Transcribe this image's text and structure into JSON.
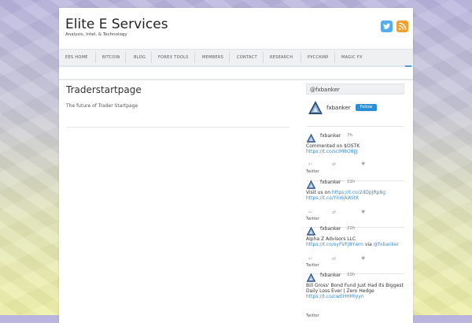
{
  "site": {
    "title": "Elite E Services",
    "tagline": "Analysis, Intel, & Technology"
  },
  "social": {
    "twitter": "twitter-icon",
    "rss": "rss-icon"
  },
  "nav": {
    "items": [
      "EES HOME",
      "BITCOIN",
      "BLOG",
      "FOREX TOOLS",
      "MEMBERS",
      "CONTACT",
      "RESEARCH",
      "РУССКИЙ",
      "MAGIC FX"
    ]
  },
  "post": {
    "title": "Traderstartpage",
    "body": "The future of Trader Startpage"
  },
  "widget": {
    "title": "@fxbanker",
    "account_name": "fxbanker",
    "follow_label": "Follow",
    "tweets": [
      {
        "name": "fxbanker",
        "time": "7h",
        "text_line1": "Commented on $OSTK",
        "text_line2": "https://t.co/scIM8O8JJJ",
        "source": "Twitter"
      },
      {
        "name": "fxbanker",
        "time": "21h",
        "text_line1_pre": "Visit us on ",
        "text_line1_link": "https://t.co/2dDpJRp6g",
        "text_line2": "https://t.co/YIn6jkAStK",
        "source": "Twitter"
      },
      {
        "name": "fxbanker",
        "time": "22h",
        "text_line1": "Alpha Z Advisors LLC",
        "text_line2_link": "https://t.co/oyFVFJ8Ywm",
        "text_line2_mid": " via ",
        "text_line2_handle": "@fxbanker",
        "source": "Twitter"
      },
      {
        "name": "fxbanker",
        "time": "22h",
        "text_line1": "Bill Gross' Bond Fund Just Had Its Biggest",
        "text_line2": "Daily Loss Ever | Zero Hedge",
        "text_line3": "https://t.co/cwEHHMIyyn",
        "source": "Twitter"
      }
    ]
  },
  "colors": {
    "accent": "#4a9fd6",
    "twitter": "#55acee",
    "rss": "#f0a030",
    "link": "#3a8bd0"
  }
}
